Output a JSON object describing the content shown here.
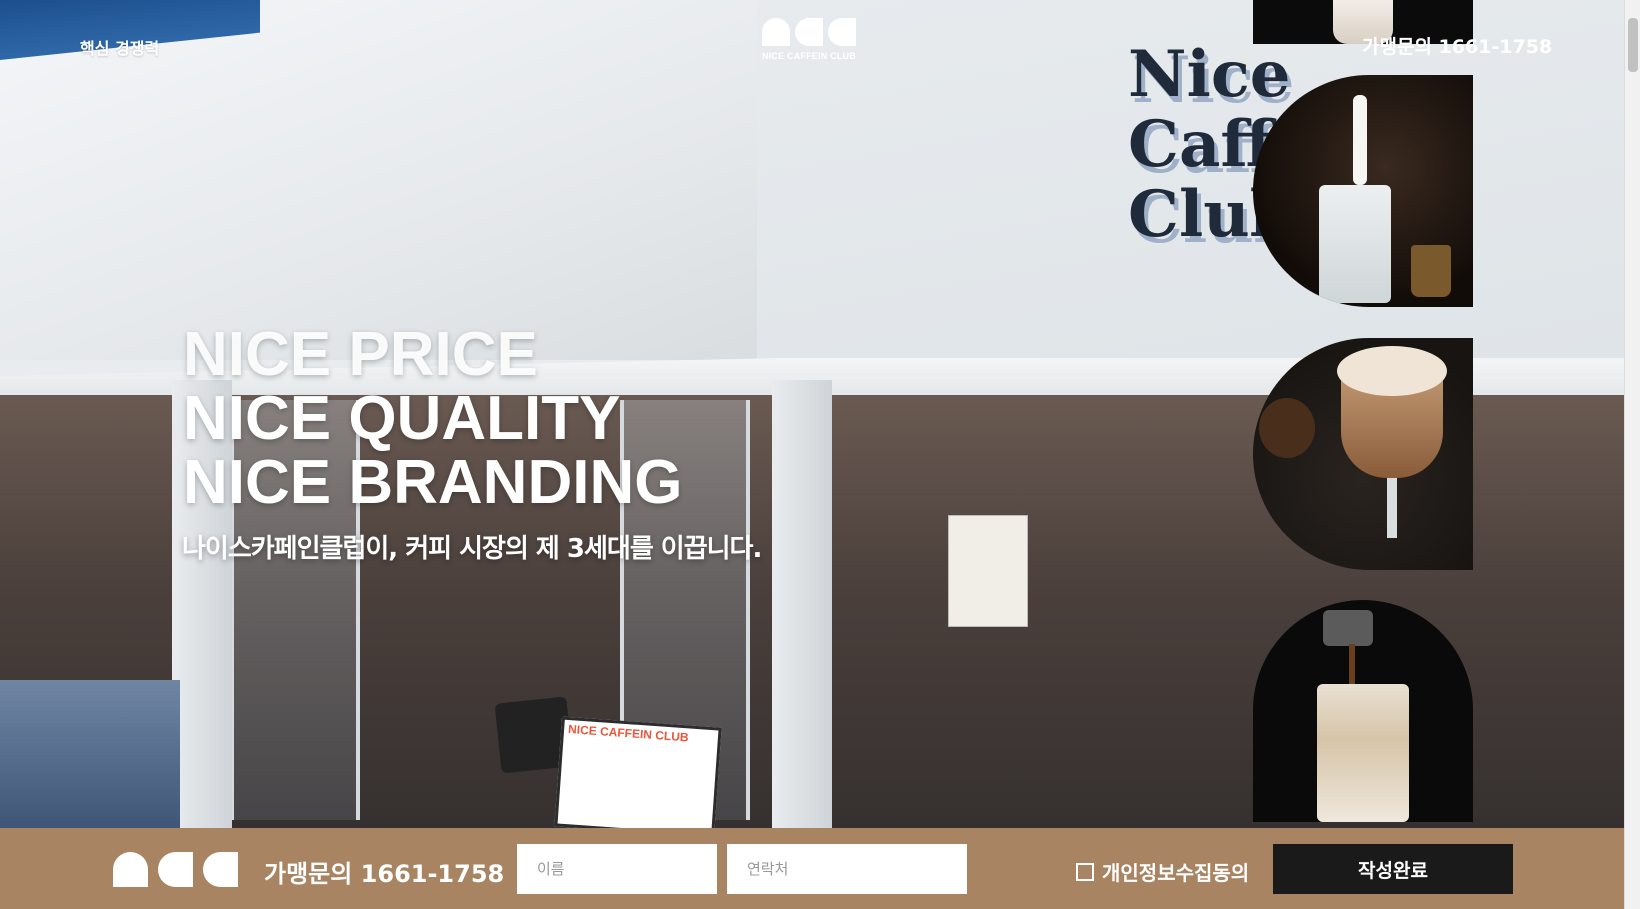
{
  "header": {
    "nav_left": "핵심 경쟁력",
    "brand_text": "NICE CAFFEIN CLUB",
    "nav_right": "가맹문의 1661-1758"
  },
  "hero": {
    "headline": [
      "NICE PRICE",
      "NICE QUALITY",
      "NICE BRANDING"
    ],
    "subhead": "나이스카페인클럽이, 커피 시장의 제 3세대를 이끕니다.",
    "sign_text": [
      "Nice",
      "Caffein",
      "Club"
    ],
    "menu_board_title": "NICE CAFFEIN CLUB"
  },
  "bottom_bar": {
    "phone": "가맹문의 1661-1758",
    "name_placeholder": "이름",
    "phone_placeholder": "연락처",
    "consent_label": "개인정보수집동의",
    "submit_label": "작성완료"
  },
  "colors": {
    "bar_background": "#a88462",
    "submit_background": "#1a1a1a"
  }
}
